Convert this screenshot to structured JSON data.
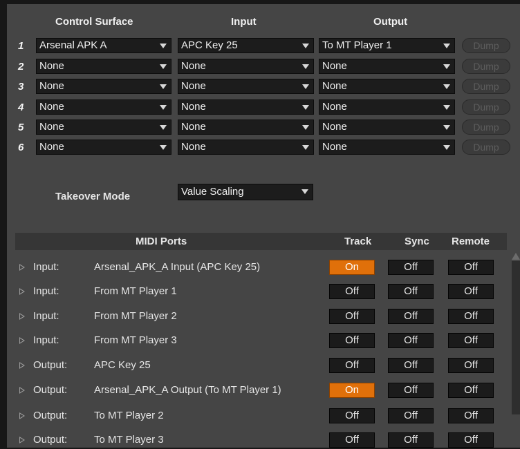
{
  "surfaces": {
    "headers": {
      "control_surface": "Control Surface",
      "input": "Input",
      "output": "Output"
    },
    "rows": [
      {
        "num": "1",
        "control": "Arsenal APK A",
        "input": "APC Key 25",
        "output": "To MT Player 1",
        "dump": "Dump"
      },
      {
        "num": "2",
        "control": "None",
        "input": "None",
        "output": "None",
        "dump": "Dump"
      },
      {
        "num": "3",
        "control": "None",
        "input": "None",
        "output": "None",
        "dump": "Dump"
      },
      {
        "num": "4",
        "control": "None",
        "input": "None",
        "output": "None",
        "dump": "Dump"
      },
      {
        "num": "5",
        "control": "None",
        "input": "None",
        "output": "None",
        "dump": "Dump"
      },
      {
        "num": "6",
        "control": "None",
        "input": "None",
        "output": "None",
        "dump": "Dump"
      }
    ]
  },
  "takeover": {
    "label": "Takeover Mode",
    "value": "Value Scaling"
  },
  "midi": {
    "headers": {
      "ports": "MIDI Ports",
      "track": "Track",
      "sync": "Sync",
      "remote": "Remote"
    },
    "rows": [
      {
        "type": "Input:",
        "name": "Arsenal_APK_A Input (APC Key 25)",
        "track": "On",
        "sync": "Off",
        "remote": "Off"
      },
      {
        "type": "Input:",
        "name": "From MT Player 1",
        "track": "Off",
        "sync": "Off",
        "remote": "Off"
      },
      {
        "type": "Input:",
        "name": "From MT Player 2",
        "track": "Off",
        "sync": "Off",
        "remote": "Off"
      },
      {
        "type": "Input:",
        "name": "From MT Player 3",
        "track": "Off",
        "sync": "Off",
        "remote": "Off"
      },
      {
        "type": "Output:",
        "name": "APC Key 25",
        "track": "Off",
        "sync": "Off",
        "remote": "Off"
      },
      {
        "type": "Output:",
        "name": "Arsenal_APK_A Output (To MT Player 1)",
        "track": "On",
        "sync": "Off",
        "remote": "Off"
      },
      {
        "type": "Output:",
        "name": "To MT Player 2",
        "track": "Off",
        "sync": "Off",
        "remote": "Off"
      },
      {
        "type": "Output:",
        "name": "To MT Player 3",
        "track": "Off",
        "sync": "Off",
        "remote": "Off"
      }
    ]
  },
  "colors": {
    "accent_on": "#e0700a",
    "panel": "#454545",
    "field": "#1c1c1c"
  }
}
